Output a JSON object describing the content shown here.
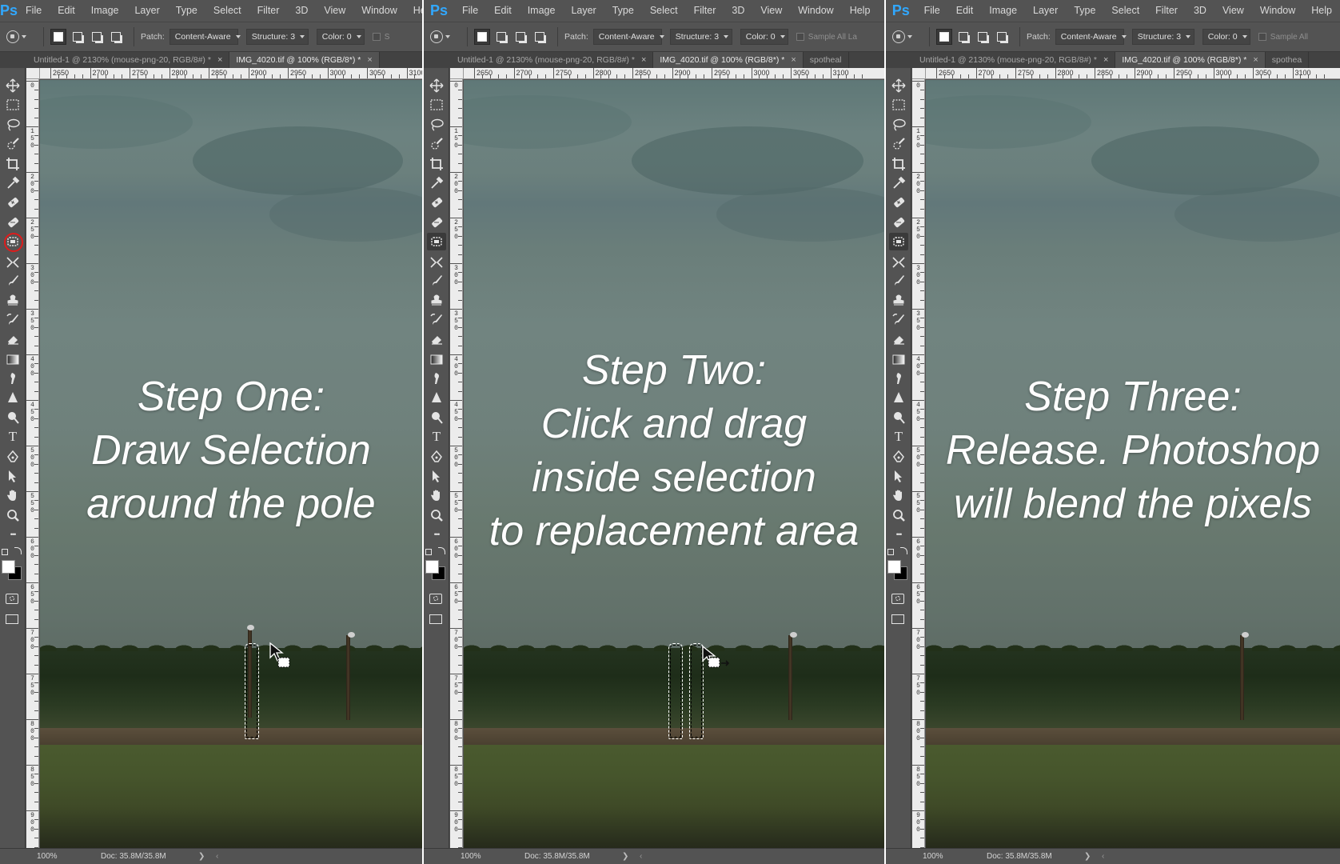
{
  "app": {
    "logo": "Ps"
  },
  "menu": [
    "File",
    "Edit",
    "Image",
    "Layer",
    "Type",
    "Select",
    "Filter",
    "3D",
    "View",
    "Window",
    "Help"
  ],
  "options": {
    "patch_label": "Patch:",
    "patch_value": "Content-Aware",
    "structure_label": "Structure: 3",
    "color_label": "Color: 0",
    "sample_all_layers": [
      "S",
      "Sample All La",
      "Sample All"
    ]
  },
  "tabs": [
    [
      "Untitled-1 @ 2130% (mouse-png-20, RGB/8#) *",
      "IMG_4020.tif @ 100% (RGB/8*) *"
    ],
    [
      "Untitled-1 @ 2130% (mouse-png-20, RGB/8#) *",
      "IMG_4020.tif @ 100% (RGB/8*) *",
      "spotheal"
    ],
    [
      "Untitled-1 @ 2130% (mouse-png-20, RGB/8#) *",
      "IMG_4020.tif @ 100% (RGB/8*) *",
      "spothea"
    ]
  ],
  "tab_close": "×",
  "ruler_top": [
    "2650",
    "2700",
    "2750",
    "2800",
    "2850",
    "2900",
    "2950",
    "3000",
    "3050",
    "3100"
  ],
  "ruler_left": [
    "0",
    "150",
    "200",
    "250",
    "300",
    "350",
    "400",
    "450",
    "500",
    "550",
    "600",
    "650",
    "700",
    "750",
    "800",
    "850",
    "900"
  ],
  "tools": [
    "move-icon",
    "rect-marquee-icon",
    "lasso-icon",
    "quick-select-icon",
    "crop-icon",
    "eyedropper-icon",
    "spot-healing-icon",
    "healing-brush-icon",
    "patch-icon",
    "content-aware-move-icon",
    "brush-icon",
    "clone-stamp-icon",
    "history-brush-icon",
    "eraser-icon",
    "gradient-icon",
    "smudge-icon",
    "sharpen-icon",
    "dodge-icon",
    "type-icon",
    "pen-icon",
    "path-select-icon",
    "hand-icon",
    "zoom-icon",
    "more-tools-icon"
  ],
  "type_tool_glyph": "T",
  "more_tools_glyph": "•••",
  "steps": [
    {
      "lines": [
        "Step One:",
        "Draw Selection",
        "around the pole"
      ]
    },
    {
      "lines": [
        "Step Two:",
        "Click and drag",
        "inside selection",
        "to replacement area"
      ]
    },
    {
      "lines": [
        "Step Three:",
        "Release. Photoshop",
        "will blend the pixels"
      ]
    }
  ],
  "status": {
    "zoom": "100%",
    "doc": "Doc: 35.8M/35.8M",
    "arrow": "❯",
    "arrow2": "‹"
  },
  "colors": {
    "accent_logo": "#31a8ff",
    "highlight_ring": "#e01b1b",
    "ui_bg": "#535353"
  }
}
